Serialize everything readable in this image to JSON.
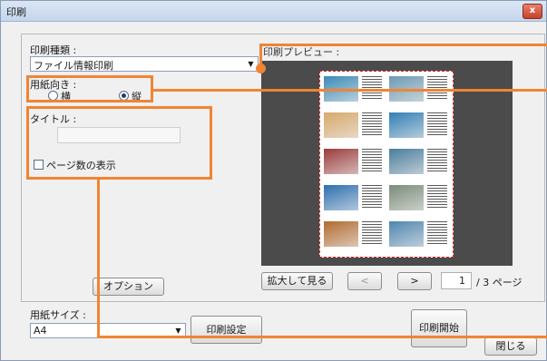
{
  "window": {
    "title": "印刷",
    "close_label": "x"
  },
  "print_type": {
    "label": "印刷種類 :",
    "value": "ファイル情報印刷"
  },
  "orientation": {
    "label": "用紙向き :",
    "landscape": "横",
    "portrait": "縦",
    "selected": "portrait"
  },
  "title_field": {
    "label": "タイトル :",
    "value": ""
  },
  "page_numbers": {
    "label": "ページ数の表示",
    "checked": false
  },
  "preview": {
    "label": "印刷プレビュー :"
  },
  "buttons": {
    "options": "オプション",
    "zoom": "拡大して見る",
    "prev": "<",
    "next": ">",
    "print_settings": "印刷設定",
    "start_print": "印刷開始",
    "close": "閉じる"
  },
  "pagination": {
    "current": "1",
    "total_label": "/ 3 ページ"
  },
  "paper_size": {
    "label": "用紙サイズ :",
    "value": "A4"
  },
  "colors": {
    "annotation": "#f08434",
    "preview_bg": "#4b4b4b",
    "sheet_border": "#dd2222"
  },
  "thumbnails": [
    "#3d8bb8",
    "#6c9ab3",
    "#d9a96a",
    "#2f7fb5",
    "#9c3b3b",
    "#4a7d9e",
    "#2b6fb0",
    "#7a8c7a",
    "#b36a2e",
    "#4f86b0"
  ]
}
